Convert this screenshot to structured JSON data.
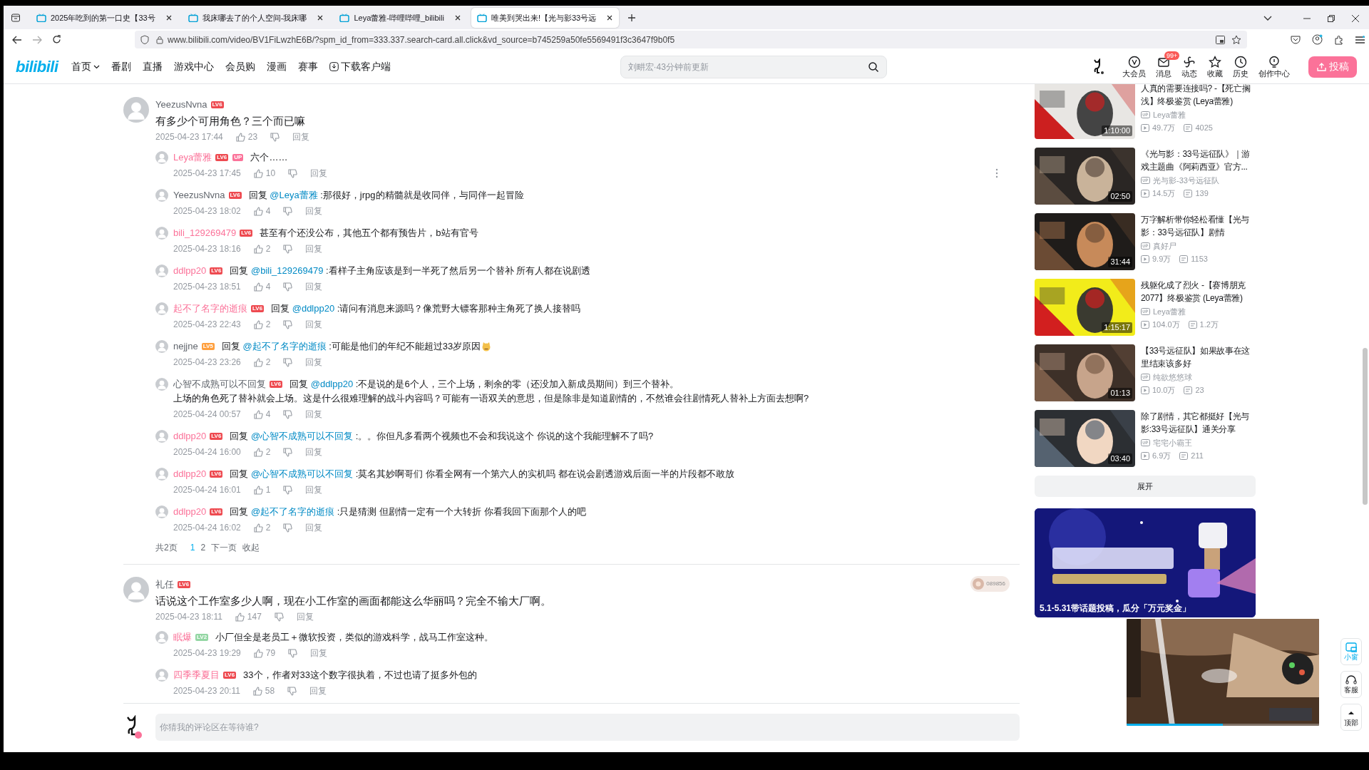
{
  "browser": {
    "tabs": [
      {
        "title": "2025年吃到的第一口史【33号",
        "selected": false
      },
      {
        "title": "我床哪去了的个人空间-我床哪",
        "selected": false
      },
      {
        "title": "Leya蕾雅-哔哩哔哩_bilibili",
        "selected": false
      },
      {
        "title": "唯美到哭出来!【光与影33号远",
        "selected": true
      }
    ],
    "url": "www.bilibili.com/video/BV1FiLwzhE6B/?spm_id_from=333.337.search-card.all.click&vd_source=b745259a50fe5569491f3c3647f9b0f5"
  },
  "header": {
    "logo": "bilibili",
    "nav": [
      {
        "label": "首页",
        "kind": "dropdown"
      },
      {
        "label": "番剧",
        "kind": "link"
      },
      {
        "label": "直播",
        "kind": "link"
      },
      {
        "label": "游戏中心",
        "kind": "link"
      },
      {
        "label": "会员购",
        "kind": "link"
      },
      {
        "label": "漫画",
        "kind": "link"
      },
      {
        "label": "赛事",
        "kind": "link"
      },
      {
        "label": "下载客户端",
        "kind": "download"
      }
    ],
    "search": {
      "placeholder": "刘畊宏·43分钟前更新"
    },
    "actions": [
      {
        "label": "大会员",
        "kind": "vip"
      },
      {
        "label": "消息",
        "kind": "message",
        "badge": "99+"
      },
      {
        "label": "动态",
        "kind": "dynamic"
      },
      {
        "label": "收藏",
        "kind": "favorite"
      },
      {
        "label": "历史",
        "kind": "history"
      },
      {
        "label": "创作中心",
        "kind": "creator"
      }
    ],
    "upload": "投稿"
  },
  "threads": [
    {
      "name": "YeezusNvna",
      "level": "LV6",
      "vip": false,
      "text": "有多少个可用角色？三个而已嘛",
      "time": "2025-04-23 17:44",
      "likes": "23",
      "action": "回复",
      "replies": [
        {
          "name": "Leya蕾雅",
          "level": "LV6",
          "vip": true,
          "up_badge": "UP",
          "text": "六个……",
          "time": "2025-04-23 17:45",
          "likes": "10",
          "action": "回复",
          "more_menu": true
        },
        {
          "name": "YeezusNvna",
          "level": "LV6",
          "vip": false,
          "prefix": "回复",
          "mention": "@Leya蕾雅",
          "text": ":那很好，jrpg的精髓就是收同伴，与同伴一起冒险",
          "time": "2025-04-23 18:02",
          "likes": "4",
          "action": "回复"
        },
        {
          "name": "bili_129269479",
          "level": "LV6",
          "vip": true,
          "text": "甚至有个还没公布，其他五个都有预告片，b站有官号",
          "time": "2025-04-23 18:16",
          "likes": "2",
          "action": "回复"
        },
        {
          "name": "ddlpp20",
          "level": "LV6",
          "vip": true,
          "prefix": "回复",
          "mention": "@bili_129269479",
          "text": ":看样子主角应该是到一半死了然后另一个替补 所有人都在说剧透",
          "time": "2025-04-23 18:51",
          "likes": "4",
          "action": "回复"
        },
        {
          "name": "起不了名字的逝痕",
          "level": "LV6",
          "vip": true,
          "prefix": "回复",
          "mention": "@ddlpp20",
          "text": ":请问有消息来源吗？像荒野大镖客那种主角死了换人接替吗",
          "time": "2025-04-23 22:43",
          "likes": "2",
          "action": "回复"
        },
        {
          "name": "nejjne",
          "level": "LV5",
          "vip": false,
          "prefix": "回复",
          "mention": "@起不了名字的逝痕",
          "text": ":可能是他们的年纪不能超过33岁原因",
          "emoji": true,
          "time": "2025-04-23 23:26",
          "likes": "2",
          "action": "回复"
        },
        {
          "name": "心智不成熟可以不回复",
          "level": "LV6",
          "vip": false,
          "prefix": "回复",
          "mention": "@ddlpp20",
          "text": ":不是说的是6个人，三个上场，剩余的零（还没加入新成员期间）到三个替补。",
          "continuation": "上场的角色死了替补就会上场。这是什么很难理解的战斗内容吗？可能有一语双关的意思，但是除非是知道剧情的，不然谁会往剧情死人替补上方面去想啊?",
          "time": "2025-04-24 00:57",
          "likes": "4",
          "action": "回复"
        },
        {
          "name": "ddlpp20",
          "level": "LV6",
          "vip": true,
          "prefix": "回复",
          "mention": "@心智不成熟可以不回复",
          "text": ":。。你但凡多看两个视频也不会和我说这个 你说的这个我能理解不了吗?",
          "time": "2025-04-24 16:00",
          "likes": "2",
          "action": "回复"
        },
        {
          "name": "ddlpp20",
          "level": "LV6",
          "vip": true,
          "prefix": "回复",
          "mention": "@心智不成熟可以不回复",
          "text": ":莫名其妙啊哥们 你看全网有一个第六人的实机吗 都在说会剧透游戏后面一半的片段都不敢放",
          "time": "2025-04-24 16:01",
          "likes": "1",
          "action": "回复"
        },
        {
          "name": "ddlpp20",
          "level": "LV6",
          "vip": true,
          "prefix": "回复",
          "mention": "@起不了名字的逝痕",
          "text": ":只是猜测 但剧情一定有一个大转折 你看我回下面那个人的吧",
          "time": "2025-04-24 16:02",
          "likes": "2",
          "action": "回复"
        }
      ],
      "pager": {
        "total": "共2页",
        "pages": [
          {
            "label": "1",
            "selected": true
          },
          {
            "label": "2",
            "selected": false
          }
        ],
        "next": "下一页",
        "collapse": "收起"
      }
    },
    {
      "name": "礼任",
      "level": "LV6",
      "vip": false,
      "text": "话说这个工作室多少人啊，现在小工作室的画面都能这么华丽吗？完全不输大厂啊。",
      "time": "2025-04-23 18:11",
      "likes": "147",
      "action": "回复",
      "decoration": "089856",
      "replies": [
        {
          "name": "眠爆",
          "level": "LV2",
          "vip": true,
          "text": "小厂但全是老员工＋微软投资，类似的游戏科学，战马工作室这种。",
          "time": "2025-04-23 19:29",
          "likes": "79",
          "action": "回复"
        },
        {
          "name": "四季季夏目",
          "level": "LV6",
          "vip": true,
          "text": "33个，作者对33这个数字很执着，不过也请了挺多外包的",
          "time": "2025-04-23 20:11",
          "likes": "58",
          "action": "回复"
        }
      ]
    }
  ],
  "comment_box": {
    "placeholder": "你猜我的评论区在等待谁?"
  },
  "recommendations": [
    {
      "title": "人真的需要连接吗? -【死亡搁浅】终极鉴赏 (Leya蕾雅)",
      "duration": "1:10:00",
      "up": "Leya蕾雅",
      "views": "49.7万",
      "danmaku": "4025"
    },
    {
      "title": "《光与影：33号远征队》｜游戏主题曲《阿莉西亚》官方...",
      "duration": "02:50",
      "up": "光与影-33号远征队",
      "views": "14.5万",
      "danmaku": "139"
    },
    {
      "title": "万字解析带你轻松看懂【光与影：33号远征队】剧情",
      "duration": "31:44",
      "up": "真好尸",
      "views": "9.9万",
      "danmaku": "1153"
    },
    {
      "title": "残躯化成了烈火 -【赛博朋克2077】终极鉴赏 (Leya蕾雅)",
      "duration": "1:15:17",
      "up": "Leya蕾雅",
      "views": "104.0万",
      "danmaku": "1.2万"
    },
    {
      "title": "【33号远征队】如果故事在这里结束该多好",
      "duration": "01:13",
      "up": "纯欲悠悠球",
      "views": "10.0万",
      "danmaku": "23"
    },
    {
      "title": "除了剧情，其它都挺好【光与影:33号远征队】通关分享",
      "duration": "03:40",
      "up": "宅宅小霸王",
      "views": "6.9万",
      "danmaku": "211"
    }
  ],
  "expand": "展开",
  "ad": {
    "caption": "5.1-5.31带话题投稿，瓜分「万元奖金」"
  },
  "mini_player": {
    "progress": {
      "level": 0.5
    }
  },
  "floats": [
    {
      "label": "小窗",
      "kind": "mini",
      "on": true
    },
    {
      "label": "客服",
      "kind": "support",
      "on": false
    },
    {
      "label": "顶部",
      "kind": "top",
      "on": false
    }
  ]
}
